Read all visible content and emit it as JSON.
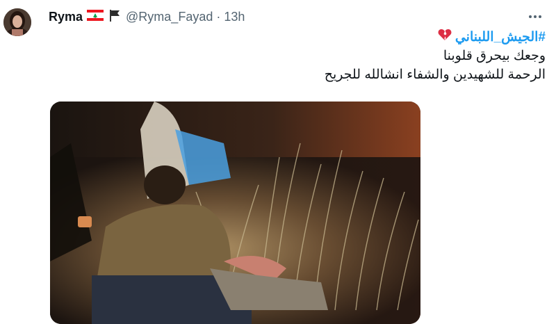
{
  "author": {
    "display_name": "Ryma",
    "handle": "@Ryma_Fayad",
    "separator": "·",
    "time": "13h",
    "flag_icon": "lebanon-flag-icon",
    "badge_icon": "black-flag-icon"
  },
  "tweet": {
    "hashtag": "#الجيش_اللبناني",
    "hashtag_emoji": "broken-heart-icon",
    "line1": "وجعك بيحرق قلوبنا",
    "line2": "الرحمة للشهيدين والشفاء انشالله للجريح"
  },
  "colors": {
    "link": "#1d9bf0",
    "secondary_text": "#536471"
  }
}
